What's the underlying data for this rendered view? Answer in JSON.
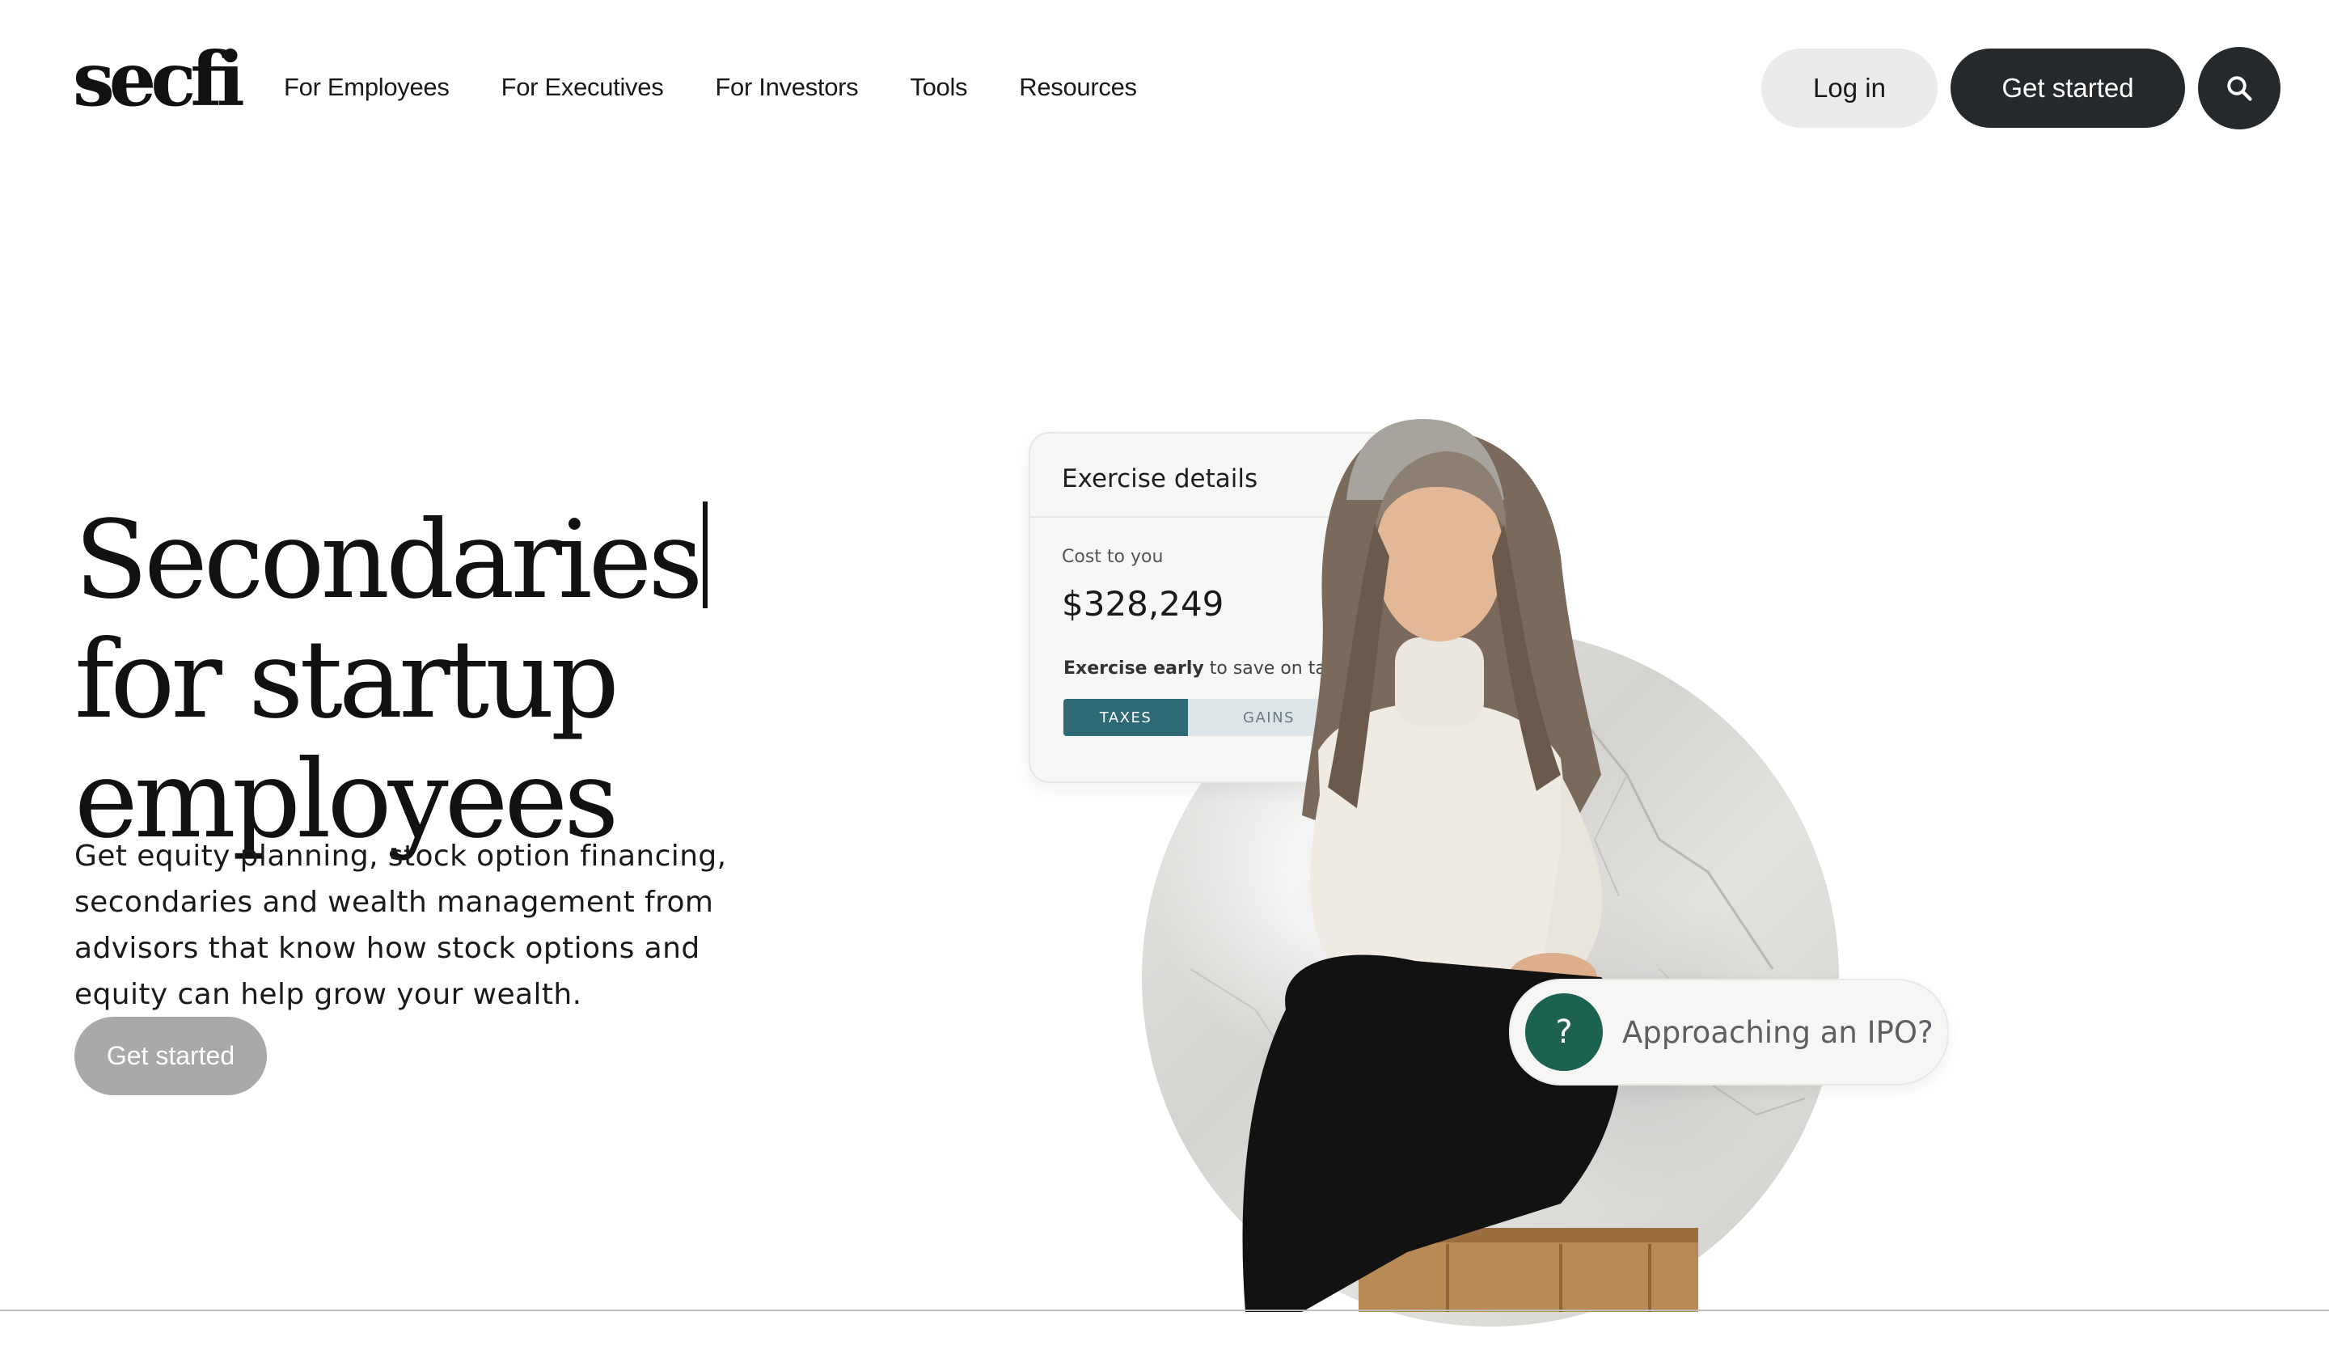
{
  "header": {
    "logo": "secfi",
    "nav": [
      "For Employees",
      "For Executives",
      "For Investors",
      "Tools",
      "Resources"
    ],
    "login_label": "Log in",
    "cta_label": "Get started",
    "search_icon": "search-icon"
  },
  "hero": {
    "title_lines": [
      "Secondaries",
      "for startup",
      "employees"
    ],
    "subtitle": "Get equity planning, stock option financing, secondaries and wealth management from advisors that know how stock options and equity can help grow your wealth.",
    "cta_label": "Get started"
  },
  "exercise_card": {
    "title": "Exercise details",
    "cost_label": "Cost to you",
    "cost_value": "$328,249",
    "note_bold": "Exercise early",
    "note_rest": "to save on taxes",
    "tabs": [
      "TAXES",
      "GAINS"
    ],
    "active_tab": "TAXES"
  },
  "ipo_prompt": {
    "icon_text": "?",
    "label": "Approaching an IPO?"
  },
  "colors": {
    "dark_button": "#26292c",
    "light_button": "#ebebeb",
    "hero_cta": "#a9a9a9",
    "teal_tab": "#2d6a75",
    "ipo_icon": "#1d6150"
  }
}
